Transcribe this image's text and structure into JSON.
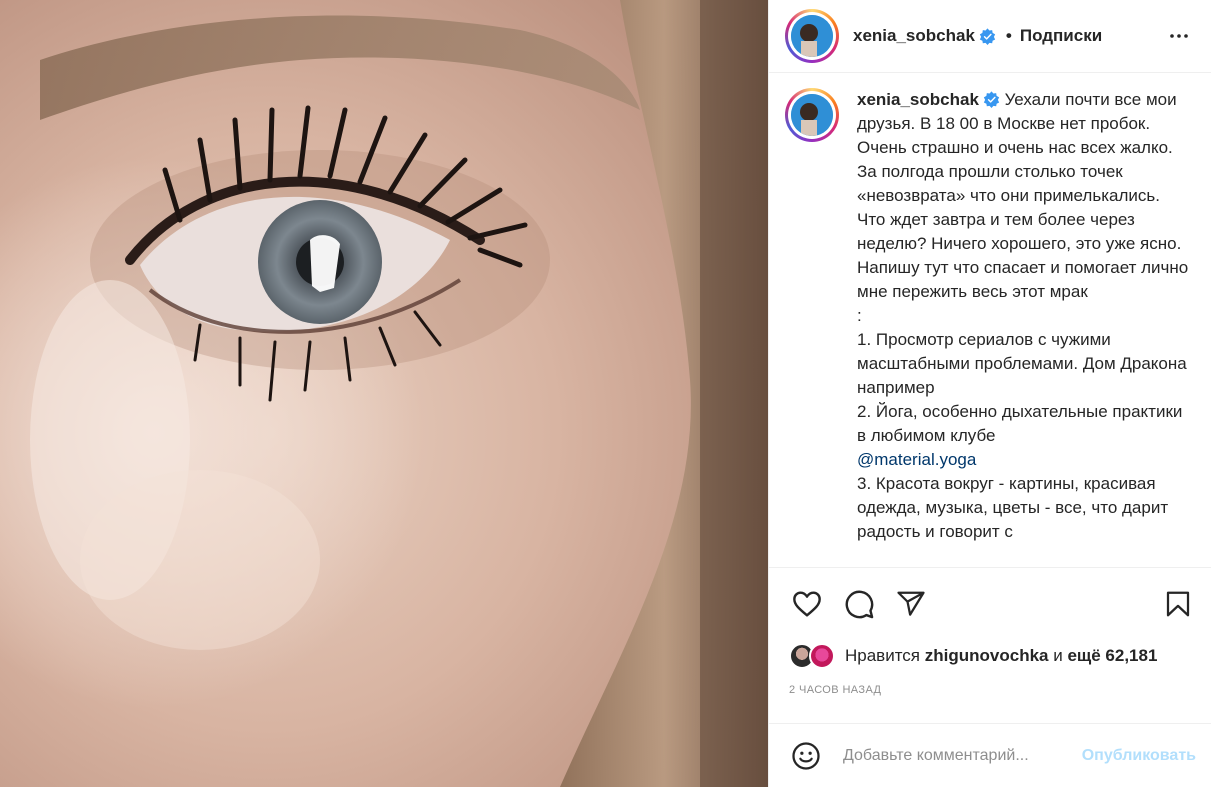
{
  "post": {
    "photo_alt": "",
    "username": "xenia_sobchak",
    "follow_label": "Подписки",
    "separator": "•"
  },
  "caption": {
    "username": "xenia_sobchak",
    "text_part1": " Уехали почти все мои друзья. В 18 00 в Москве нет пробок. Очень страшно и очень нас всех жалко. За полгода прошли столько точек «невозврата» что они примелькались. Что ждет завтра и тем более через неделю? Ничего хорошего, это уже ясно.\nНапишу тут что спасает и помогает лично мне пережить весь этот мрак\n:\n1. Просмотр сериалов с чужими масштабными проблемами. Дом Дракона например\n2. Йога, особенно дыхательные практики в любимом клубе\n",
    "mention": "@material.yoga",
    "text_part2": "\n3. Красота вокруг - картины, красивая одежда, музыка, цветы - все, что дарит радость и говорит с"
  },
  "actions": {
    "like_icon": "heart-icon",
    "comment_icon": "comment-icon",
    "share_icon": "paper-plane-icon",
    "save_icon": "bookmark-icon"
  },
  "likes": {
    "prefix": "Нравится ",
    "user": "zhigunovochka",
    "middle": " и ",
    "count": "ещё 62,181"
  },
  "time_ago": "2 часов назад",
  "comment": {
    "placeholder": "Добавьте комментарий...",
    "publish_label": "Опубликовать"
  },
  "colors": {
    "link": "#00376b",
    "publish_disabled": "#b2dffc",
    "verified": "#3897f0",
    "muted": "#8e8e8e"
  }
}
